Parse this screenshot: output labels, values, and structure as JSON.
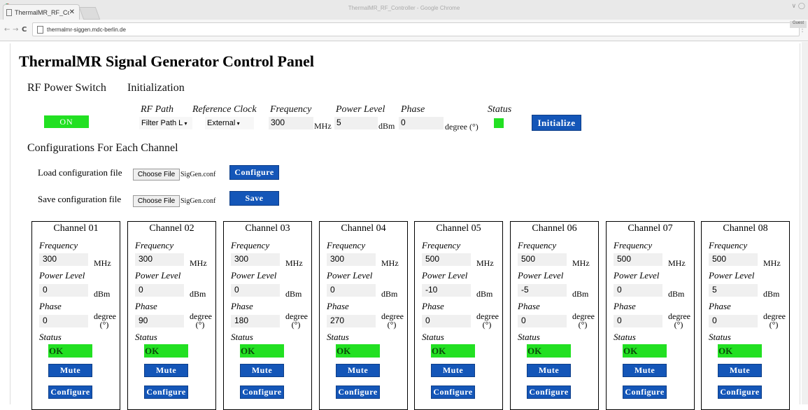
{
  "browser": {
    "window_title": "ThermalMR_RF_Controller - Google Chrome",
    "tab_title": "ThermalMR_RF_Contr",
    "url": "thermalmr-siggen.mdc-berlin.de",
    "user_chip": "Guest"
  },
  "page": {
    "title": "ThermalMR Signal Generator Control Panel",
    "rf_power_switch_label": "RF Power Switch",
    "initialization_label": "Initialization",
    "power_button": "ON",
    "init": {
      "rf_path_label": "RF Path",
      "rf_path_value": "Filter Path L",
      "ref_clock_label": "Reference Clock",
      "ref_clock_value": "External",
      "frequency_label": "Frequency",
      "frequency_value": "300",
      "frequency_unit": "MHz",
      "power_label": "Power Level",
      "power_value": "5",
      "power_unit": "dBm",
      "phase_label": "Phase",
      "phase_value": "0",
      "phase_unit": "degree (°)",
      "status_label": "Status",
      "initialize_button": "Initialize"
    },
    "config_title": "Configurations For Each Channel",
    "load_label": "Load configuration file",
    "save_label": "Save configuration file",
    "choose_file": "Choose File",
    "load_filename": "SigGen.conf",
    "save_filename": "SigGen.conf",
    "configure_button": "Configure",
    "save_button": "Save"
  },
  "channel_labels": {
    "frequency": "Frequency",
    "power": "Power Level",
    "phase": "Phase",
    "status": "Status",
    "freq_unit": "MHz",
    "power_unit": "dBm",
    "phase_unit_1": "degree",
    "phase_unit_2": "(°)",
    "ok": "OK",
    "mute": "Mute",
    "configure": "Configure"
  },
  "channels": [
    {
      "name": "Channel 01",
      "frequency": "300",
      "power": "0",
      "phase": "0"
    },
    {
      "name": "Channel 02",
      "frequency": "300",
      "power": "0",
      "phase": "90"
    },
    {
      "name": "Channel 03",
      "frequency": "300",
      "power": "0",
      "phase": "180"
    },
    {
      "name": "Channel 04",
      "frequency": "300",
      "power": "0",
      "phase": "270"
    },
    {
      "name": "Channel 05",
      "frequency": "500",
      "power": "-10",
      "phase": "0"
    },
    {
      "name": "Channel 06",
      "frequency": "500",
      "power": "-5",
      "phase": "0"
    },
    {
      "name": "Channel 07",
      "frequency": "500",
      "power": "0",
      "phase": "0"
    },
    {
      "name": "Channel 08",
      "frequency": "500",
      "power": "5",
      "phase": "0"
    }
  ],
  "colors": {
    "status_ok": "#22e022",
    "button_blue": "#1456b8"
  }
}
